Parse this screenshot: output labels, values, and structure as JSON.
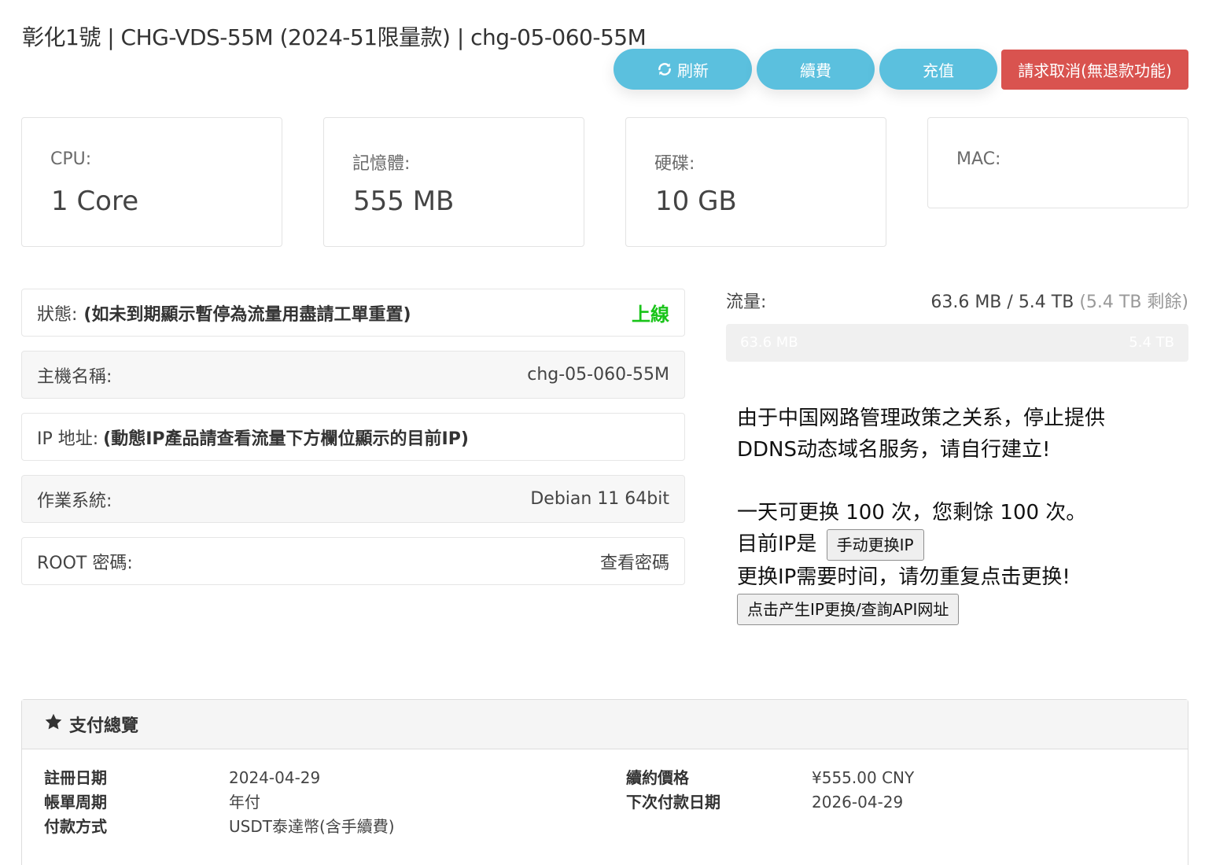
{
  "header": {
    "title": "彰化1號 | CHG-VDS-55M (2024-51限量款) | chg-05-060-55M"
  },
  "actions": {
    "refresh_label": "刷新",
    "renew_label": "續費",
    "topup_label": "充值",
    "cancel_label": "請求取消(無退款功能)"
  },
  "specs": {
    "cpu_label": "CPU:",
    "cpu_value": "1 Core",
    "memory_label": "記憶體:",
    "memory_value": "555 MB",
    "disk_label": "硬碟:",
    "disk_value": "10 GB",
    "mac_label": "MAC:"
  },
  "info": {
    "status_label": "狀態:",
    "status_note": "(如未到期顯示暫停為流量用盡請工單重置)",
    "status_value": "上線",
    "hostname_label": "主機名稱:",
    "hostname_value": "chg-05-060-55M",
    "ip_label": "IP 地址:",
    "ip_note": "(動態IP產品請查看流量下方欄位顯示的目前IP)",
    "os_label": "作業系統:",
    "os_value": "Debian 11 64bit",
    "root_label": "ROOT 密碼:",
    "root_value": "查看密碼"
  },
  "traffic": {
    "label": "流量:",
    "used": "63.6 MB",
    "total": "5.4 TB",
    "remaining_text": "(5.4 TB 剩餘)",
    "bar_left": "63.6 MB",
    "bar_right": "5.4 TB",
    "used_fraction": 1.15e-05
  },
  "notice": {
    "line1": "由于中国网路管理政策之关系，停止提供",
    "line2": "DDNS动态域名服务，请自行建立!",
    "line3": "一天可更换 100 次，您剩馀 100 次。",
    "current_ip_prefix": "目前IP是",
    "change_ip_button": "手动更换IP",
    "line5": "更换IP需要时间，请勿重复点击更换!",
    "api_button": "点击产生IP更换/查詢API网址"
  },
  "payment": {
    "title": "支付總覽",
    "reg_date_label": "註冊日期",
    "reg_date_value": "2024-04-29",
    "cycle_label": "帳單周期",
    "cycle_value": "年付",
    "method_label": "付款方式",
    "method_value": "USDT泰達幣(含手續費)",
    "renew_price_label": "續約價格",
    "renew_price_value": "¥555.00 CNY",
    "next_due_label": "下次付款日期",
    "next_due_value": "2026-04-29"
  },
  "colors": {
    "info_button": "#5bc0de",
    "danger_button": "#d9534f",
    "online": "#19c419"
  },
  "icons": [
    "refresh-icon",
    "star-icon"
  ]
}
